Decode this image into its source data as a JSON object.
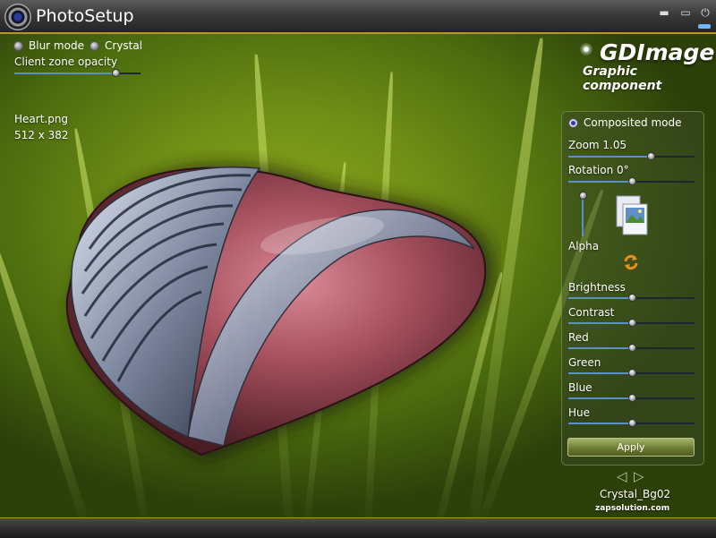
{
  "window": {
    "title": "PhotoSetup"
  },
  "top_controls": {
    "blur_mode_label": "Blur mode",
    "crystal_label": "Crystal",
    "opacity_label": "Client zone opacity",
    "opacity_value": 0.8
  },
  "image_info": {
    "filename": "Heart.png",
    "dimensions": "512 x 382"
  },
  "logo": {
    "title": "GDImage",
    "subtitle": "Graphic component"
  },
  "panel": {
    "composited_label": "Composited mode",
    "zoom_label": "Zoom 1.05",
    "zoom_value": 0.65,
    "rotation_label": "Rotation 0°",
    "rotation_value": 0.5,
    "alpha_label": "Alpha",
    "alpha_value": 1.0,
    "adjustments": [
      {
        "label": "Brightness",
        "value": 0.5
      },
      {
        "label": "Contrast",
        "value": 0.5
      },
      {
        "label": "Red",
        "value": 0.5
      },
      {
        "label": "Green",
        "value": 0.5
      },
      {
        "label": "Blue",
        "value": 0.5
      },
      {
        "label": "Hue",
        "value": 0.5
      }
    ],
    "apply_label": "Apply"
  },
  "background": {
    "name": "Crystal_Bg02",
    "site": "zapsolution.com"
  },
  "icons": {
    "app": "camera-lens-icon",
    "minimize": "minimize-icon",
    "maximize": "maximize-icon",
    "power": "power-icon",
    "preview": "image-preview-icon",
    "refresh": "refresh-icon",
    "prev": "previous-arrow-icon",
    "next": "next-arrow-icon"
  },
  "colors": {
    "accent": "#b8962a",
    "slider_fill": "#5a90c8",
    "panel_bg": "#3a4824"
  }
}
